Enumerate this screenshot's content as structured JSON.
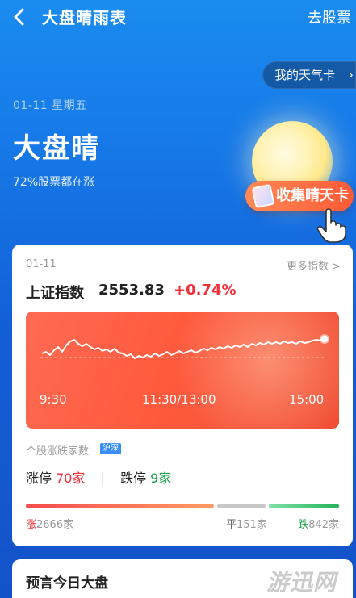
{
  "header": {
    "title": "大盘晴雨表",
    "go_stocks": "去股票"
  },
  "my_weather_card": "我的天气卡",
  "hero": {
    "date": "01-11  星期五",
    "weather": "大盘晴",
    "summary": "72%股票都在涨",
    "collect_button": "收集晴天卡"
  },
  "index_card": {
    "date": "01-11",
    "more": "更多指数 >",
    "name": "上证指数",
    "value": "2553.83",
    "change": "+0.74%",
    "chart_ticks": [
      "9:30",
      "11:30/13:00",
      "15:00"
    ],
    "updown_title": "个股涨跌家数",
    "market_tag": "沪深",
    "limit_up_label": "涨停",
    "limit_up_value": "70家",
    "limit_down_label": "跌停",
    "limit_down_value": "9家",
    "breadth": {
      "up_char": "涨",
      "up_value": "2666家",
      "flat_char": "平",
      "flat_value": "151家",
      "down_char": "跌",
      "down_value": "842家",
      "up_count": 2666,
      "flat_count": 151,
      "down_count": 842
    },
    "colors": {
      "up": "#f0313a",
      "down": "#1aa34a"
    }
  },
  "predict_card": {
    "title": "预言今日大盘"
  },
  "watermark": "游迅网"
}
